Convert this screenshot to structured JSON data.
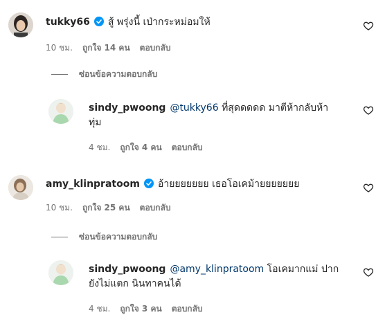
{
  "comments": [
    {
      "username": "tukky66",
      "verified": true,
      "text": "สู้ พรุ่งนี้ เป่ากระหม่อมให้",
      "time": "10 ชม.",
      "likes": "ถูกใจ 14 คน",
      "reply": "ตอบกลับ",
      "hide_replies": "ซ่อนข้อความตอบกลับ",
      "replies": [
        {
          "username": "sindy_pwoong",
          "mention": "@tukky66",
          "text": " ที่สุดดดดด มาตีห้ากลับห้า",
          "text_cont": "ทุ่ม",
          "time": "4 ชม.",
          "likes": "ถูกใจ 4 คน",
          "reply": "ตอบกลับ"
        }
      ]
    },
    {
      "username": "amy_klinpratoom",
      "verified": true,
      "text": "อ้ายยยยยยย เธอโอเคม้ายยยยยยย",
      "time": "10 ชม.",
      "likes": "ถูกใจ 25 คน",
      "reply": "ตอบกลับ",
      "hide_replies": "ซ่อนข้อความตอบกลับ",
      "replies": [
        {
          "username": "sindy_pwoong",
          "mention": "@amy_klinpratoom",
          "text": " โอเคมากแม่ ปาก",
          "text_cont": "ยังไม่แตก นินทาคนได้",
          "time": "4 ชม.",
          "likes": "ถูกใจ 3 คน",
          "reply": "ตอบกลับ"
        }
      ]
    }
  ],
  "colors": {
    "text": "#262626",
    "secondary": "#737373",
    "verified": "#0095f6",
    "mention": "#00376b"
  },
  "icons": {
    "like": "heart-outline-icon",
    "verified": "verified-badge-icon"
  }
}
